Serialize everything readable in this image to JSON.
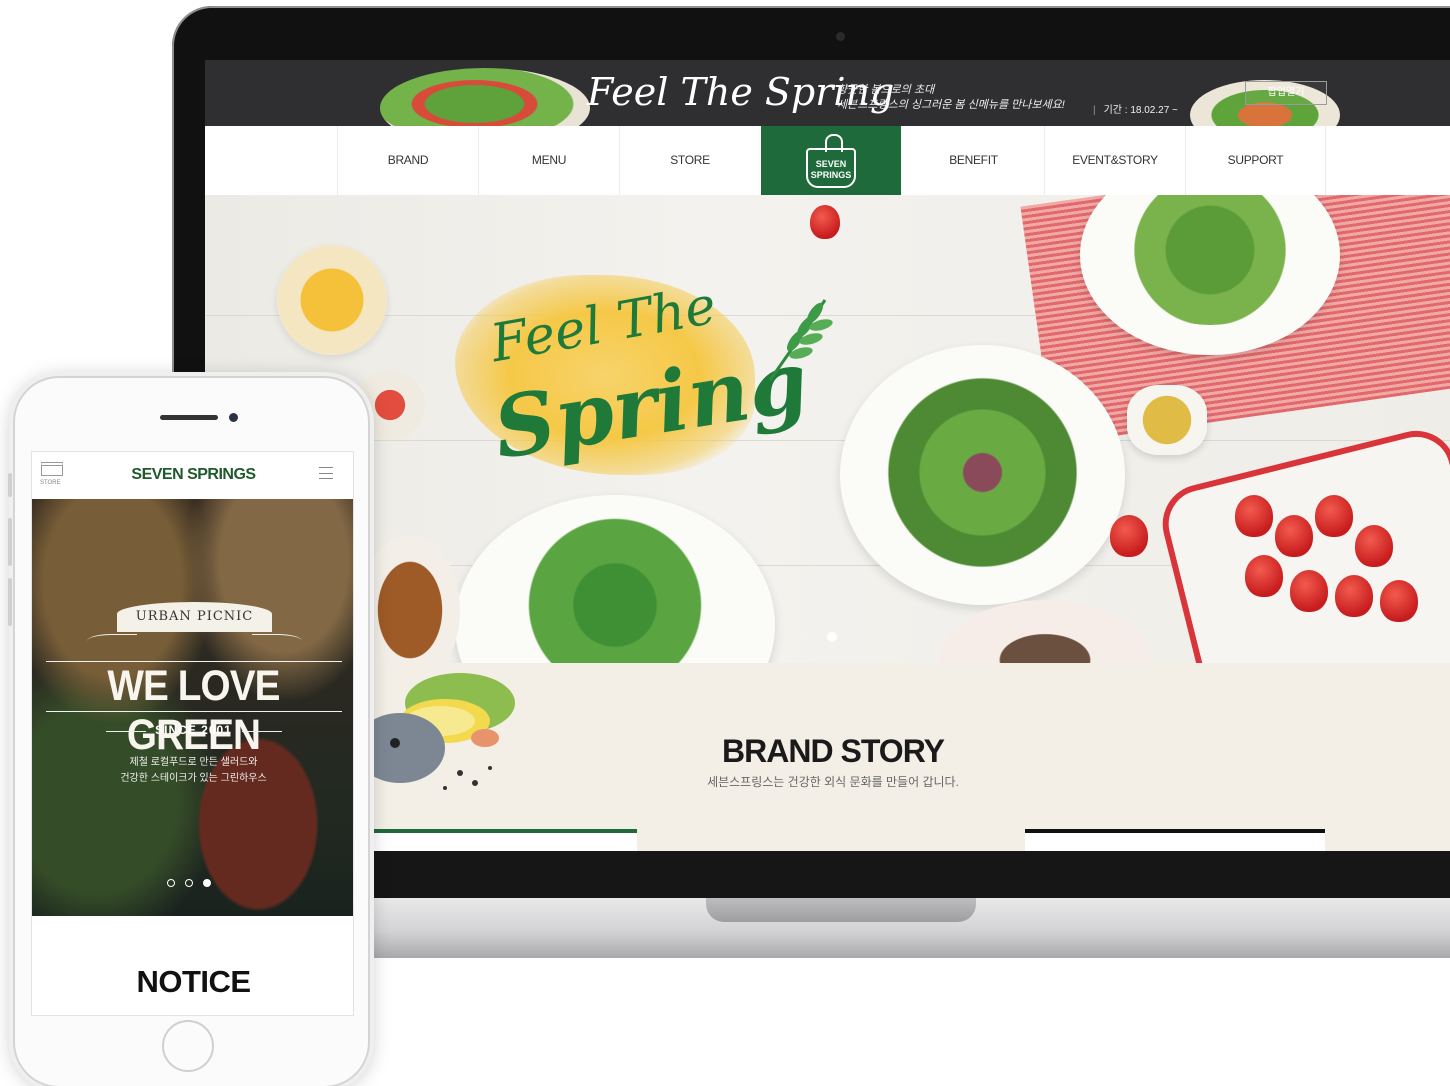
{
  "promo": {
    "title": "Feel The Spring",
    "line1": "향긋한 봄으로의 초대",
    "line2": "세븐스프링스의 싱그러운 봄 신메뉴를 만나보세요!",
    "period": "기간 : 18.02.27 ~",
    "button": "팝업열기"
  },
  "nav": {
    "items": [
      "BRAND",
      "MENU",
      "STORE",
      "BENEFIT",
      "EVENT&STORY",
      "SUPPORT"
    ],
    "logo_top": "SEVEN",
    "logo_bottom": "SPRINGS"
  },
  "hero": {
    "line1": "Feel The",
    "line2": "Spring"
  },
  "story": {
    "title": "BRAND STORY",
    "subtitle": "세븐스프링스는 건강한 외식 문화를 만들어 갑니다."
  },
  "mobile": {
    "store_label": "STORE",
    "brand": "SEVEN SPRINGS",
    "ribbon": "URBAN PICNIC",
    "headline": "WE LOVE GREEN",
    "since": "SINCE 2001",
    "desc_line1": "제철 로컬푸드로 만든 샐러드와",
    "desc_line2": "건강한 스테이크가 있는 그린하우스",
    "slide_count": 3,
    "active_slide": 3,
    "notice": "NOTICE"
  },
  "colors": {
    "brand_green": "#1e6a3a",
    "promo_bg": "#2f2f31",
    "story_bg": "#f3efe7"
  },
  "icons": [
    "store-icon",
    "hamburger-menu-icon",
    "basket-logo-icon",
    "leaf-sprig-icon"
  ]
}
